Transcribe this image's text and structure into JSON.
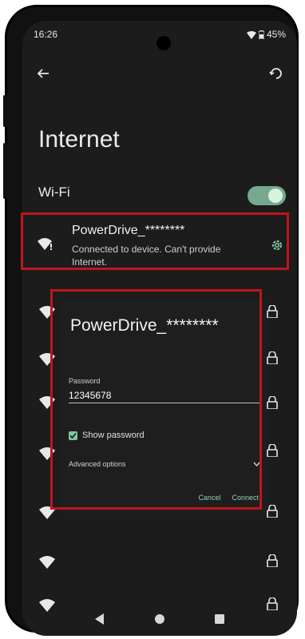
{
  "status_bar": {
    "time": "16:26",
    "battery": "45%"
  },
  "header": {
    "back_icon": "arrow-left-icon",
    "refresh_icon": "refresh-icon"
  },
  "page": {
    "title": "Internet"
  },
  "wifi": {
    "label": "Wi-Fi",
    "enabled": true
  },
  "connected_network": {
    "name": "PowerDrive_********",
    "status": "Connected to device. Can't provide Internet.",
    "settings_icon": "gear-icon"
  },
  "dialog": {
    "title": "PowerDrive_********",
    "password_label": "Password",
    "password_value": "12345678",
    "show_password_label": "Show password",
    "show_password_checked": true,
    "advanced_label": "Advanced options",
    "cancel_label": "Cancel",
    "connect_label": "Connect"
  },
  "colors": {
    "accent": "#7fc7a1",
    "highlight": "#c0151b",
    "background": "#1c1c1c"
  }
}
